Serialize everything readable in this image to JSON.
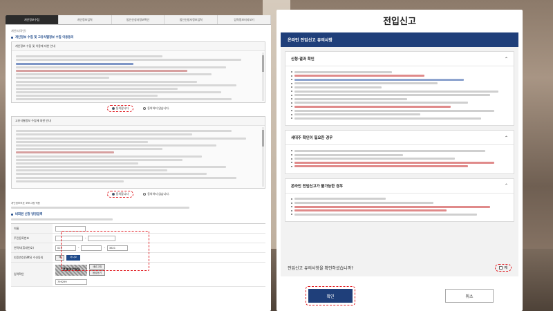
{
  "left": {
    "tabs": [
      "개인정보수집",
      "개인정보입력",
      "법인신청자정보확인",
      "법인신청자정보입력",
      "입력정보미리보기"
    ],
    "section_label": "개인(내국인)",
    "section_head": "개인정보 수집 및 고유식별정보 수집 이용동의",
    "box1_title": "개인정보 수집 및 이용에 대한 안내",
    "agree_label": "동의합니다",
    "disagree_label": "동의하지 않습니다.",
    "box2_title": "고유식별정보 수집에 대한 안내",
    "privacy_note": "개인정보보호 포토그램 적용",
    "form_head": "비회원 신청 방정입력",
    "name_label": "이름",
    "rrn_label": "주민등록번호",
    "rrn_sep": "-",
    "phone_label": "연락처(휴대번호)",
    "phone": [
      "010",
      "",
      "3621"
    ],
    "auth_label": "인증번호(SMS) 수신동의",
    "auth_yes": "예",
    "auth_no": "아니오",
    "captcha_label": "입력확인",
    "captcha_text": "799299",
    "captcha_input": "799299",
    "captcha_refresh": "새로고침",
    "captcha_audio": "음성듣기"
  },
  "right": {
    "title": "전입신고",
    "header": "온라인 전입신고 유의사항",
    "section1": "신청·결과 확인",
    "section2": "세대주 확인이 필요한 경우",
    "section3": "온라인 전입신고가 불가능한 경우",
    "confirm_question": "전입신고 유의사항을 확인하셨습니까?",
    "confirm_check": "예",
    "btn_confirm": "확인",
    "btn_cancel": "취소"
  }
}
